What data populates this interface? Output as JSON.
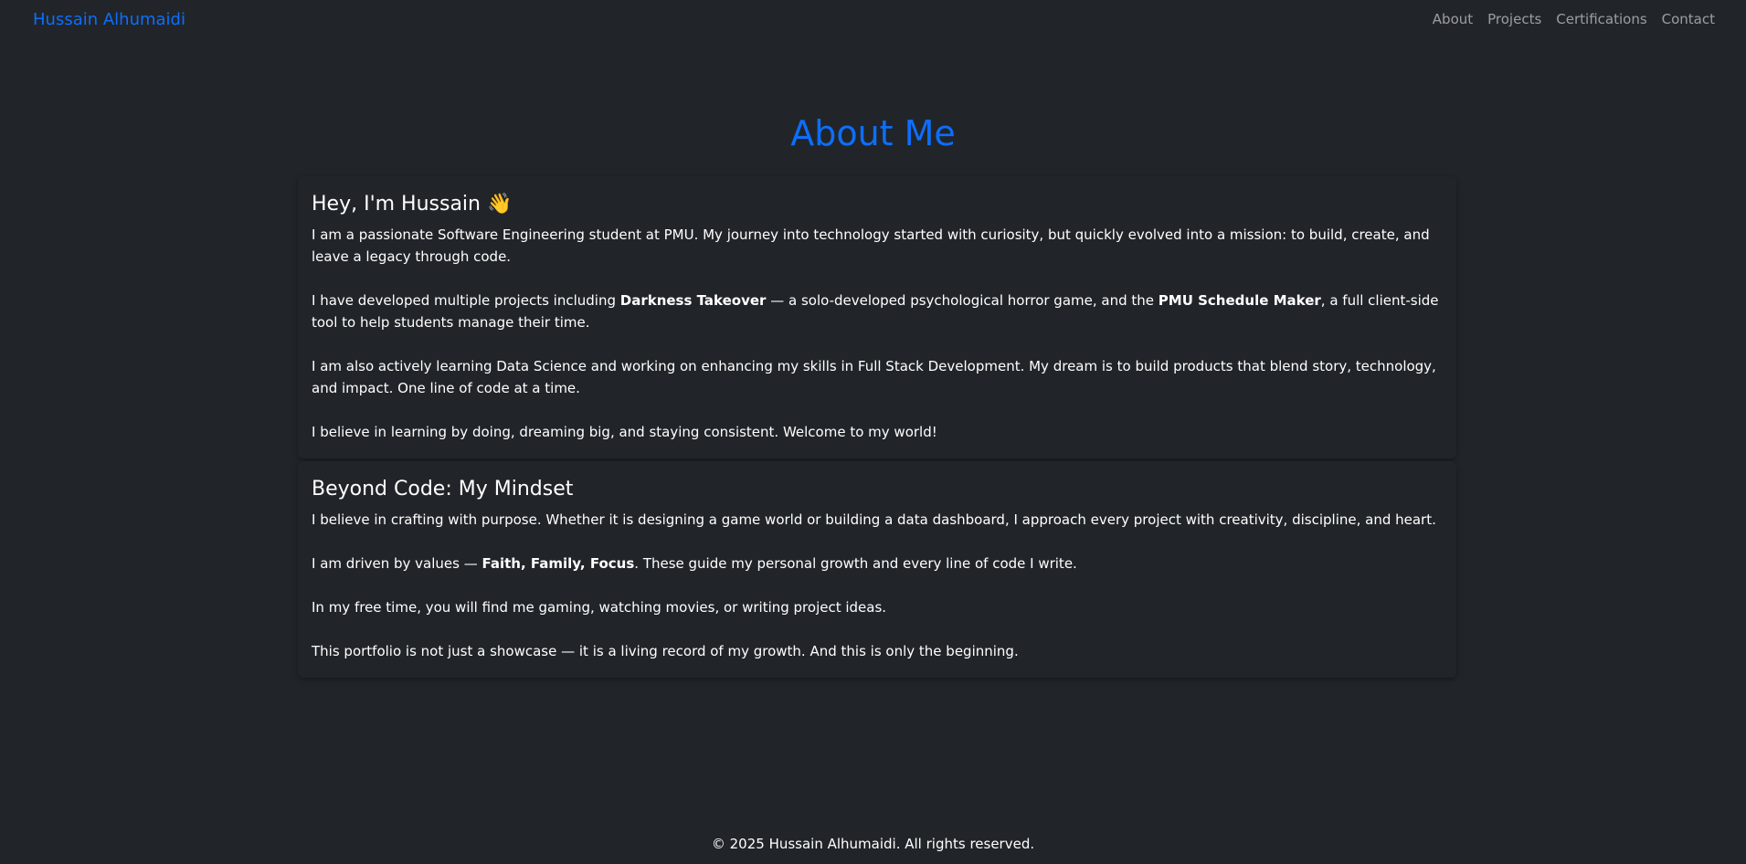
{
  "navbar": {
    "brand": "Hussain Alhumaidi",
    "links": [
      "About",
      "Projects",
      "Certifications",
      "Contact"
    ]
  },
  "page": {
    "title": "About Me"
  },
  "cards": [
    {
      "heading": "Hey, I'm Hussain 👋",
      "paragraphs": [
        {
          "parts": [
            {
              "t": "I am a passionate Software Engineering student at PMU. My journey into technology started with curiosity, but quickly evolved into a mission: to build, create, and leave a legacy through code."
            }
          ]
        },
        {
          "parts": [
            {
              "t": "I have developed multiple projects including "
            },
            {
              "t": "Darkness Takeover",
              "b": true
            },
            {
              "t": " — a solo-developed psychological horror game, and the "
            },
            {
              "t": "PMU Schedule Maker",
              "b": true
            },
            {
              "t": ", a full client-side tool to help students manage their time."
            }
          ]
        },
        {
          "parts": [
            {
              "t": "I am also actively learning Data Science and working on enhancing my skills in Full Stack Development. My dream is to build products that blend story, technology, and impact. One line of code at a time."
            }
          ]
        },
        {
          "parts": [
            {
              "t": "I believe in learning by doing, dreaming big, and staying consistent. Welcome to my world!"
            }
          ]
        }
      ]
    },
    {
      "heading": "Beyond Code: My Mindset",
      "paragraphs": [
        {
          "parts": [
            {
              "t": "I believe in crafting with purpose. Whether it is designing a game world or building a data dashboard, I approach every project with creativity, discipline, and heart."
            }
          ]
        },
        {
          "parts": [
            {
              "t": "I am driven by values — "
            },
            {
              "t": "Faith, Family, Focus",
              "b": true
            },
            {
              "t": ". These guide my personal growth and every line of code I write."
            }
          ]
        },
        {
          "parts": [
            {
              "t": "In my free time, you will find me gaming, watching movies, or writing project ideas."
            }
          ]
        },
        {
          "parts": [
            {
              "t": "This portfolio is not just a showcase — it is a living record of my growth. And this is only the beginning."
            }
          ]
        }
      ]
    }
  ],
  "footer": {
    "text": "© 2025 Hussain Alhumaidi. All rights reserved."
  },
  "colors": {
    "background": "#212529",
    "accent": "#0d6efd",
    "nav_link": "#8c8f93",
    "text": "#ffffff"
  }
}
